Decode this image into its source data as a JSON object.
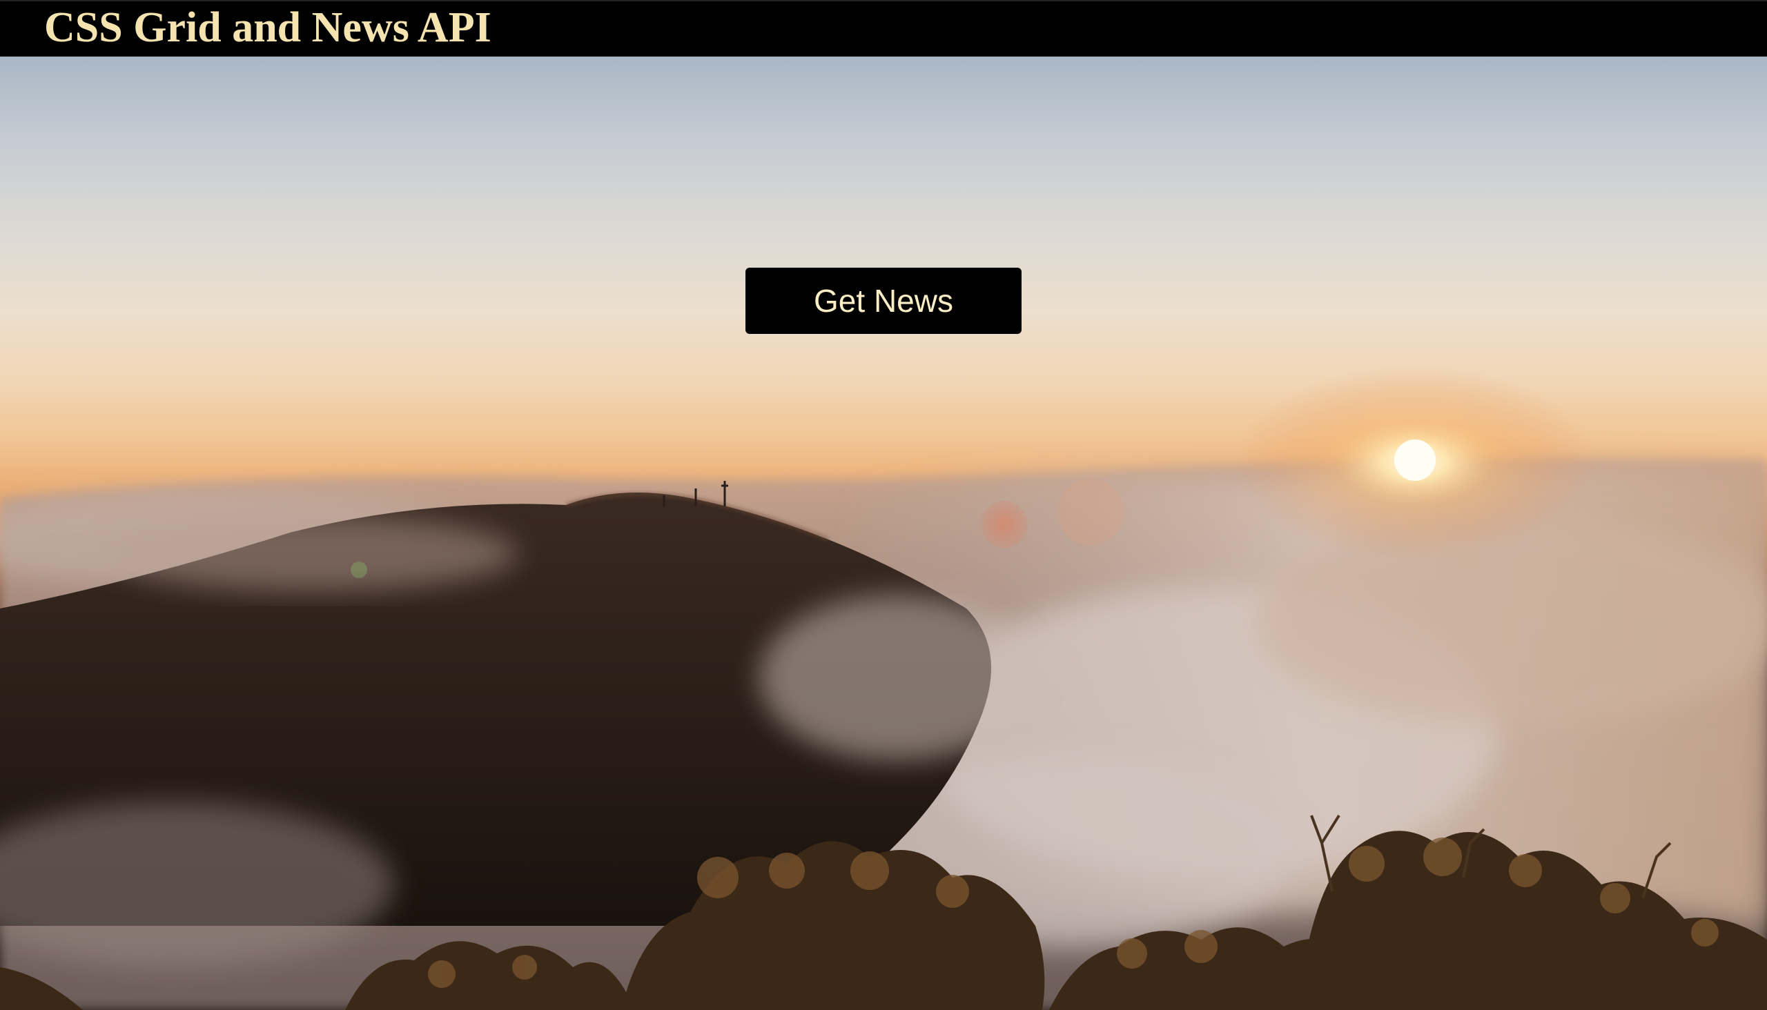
{
  "header": {
    "title": "CSS Grid and News API"
  },
  "main": {
    "get_news_label": "Get News"
  },
  "colors": {
    "header_background": "#000000",
    "header_text": "#f6e4b0",
    "button_background": "#000000",
    "button_text": "#fbeec5"
  }
}
